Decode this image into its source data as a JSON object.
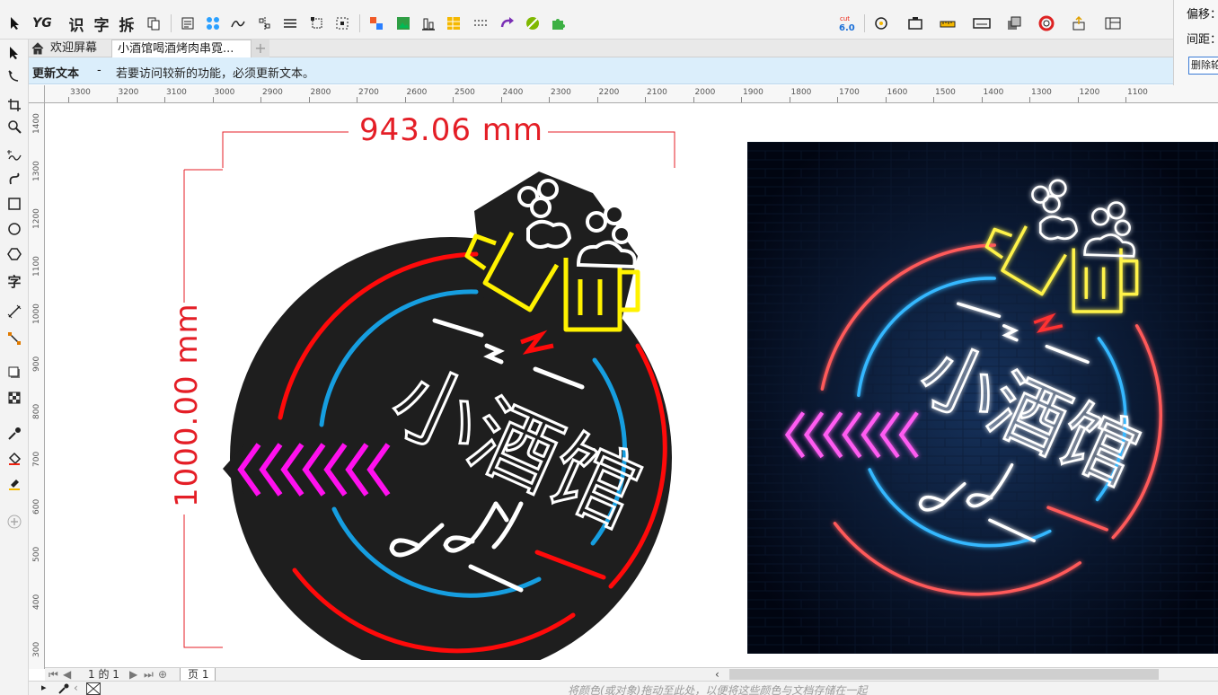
{
  "toolbar": {
    "text_tools": [
      "识",
      "字",
      "拆"
    ]
  },
  "panel": {
    "offset_label": "偏移：",
    "spacing_label": "间距：",
    "delete_button": "删除轮廓"
  },
  "tabs": {
    "welcome": "欢迎屏幕",
    "document": "小酒馆喝酒烤肉串霓...",
    "add": "+"
  },
  "update_bar": {
    "title": "更新文本",
    "dash": "-",
    "message": "若要访问较新的功能，必须更新文本。"
  },
  "ruler": {
    "h_ticks": [
      "3300",
      "3200",
      "3100",
      "3000",
      "2900",
      "2800",
      "2700",
      "2600",
      "2500",
      "2400",
      "2300",
      "2200",
      "2100",
      "2000",
      "1900",
      "1800",
      "1700",
      "1600",
      "1500",
      "1400",
      "1300",
      "1200",
      "1100"
    ],
    "v_ticks": [
      "1400",
      "1300",
      "1200",
      "1100",
      "1000",
      "900",
      "800",
      "700",
      "600",
      "500",
      "400",
      "300"
    ]
  },
  "dimensions": {
    "width": "943.06 mm",
    "height": "1000.00 mm"
  },
  "sign": {
    "text": "小酒馆"
  },
  "pages": {
    "counter": "1 的 1",
    "page_tab": "页 1"
  },
  "status": {
    "hint": "将颜色(或对象)拖动至此处，以便将这些颜色与文档存储在一起"
  },
  "colors": {
    "dimension": "#e41e26",
    "ring_red": "#ff0a0a",
    "ring_blue": "#169ee0",
    "arrows": "#ff10ee",
    "beer": "#fff200",
    "plate": "#1e1e1e"
  }
}
